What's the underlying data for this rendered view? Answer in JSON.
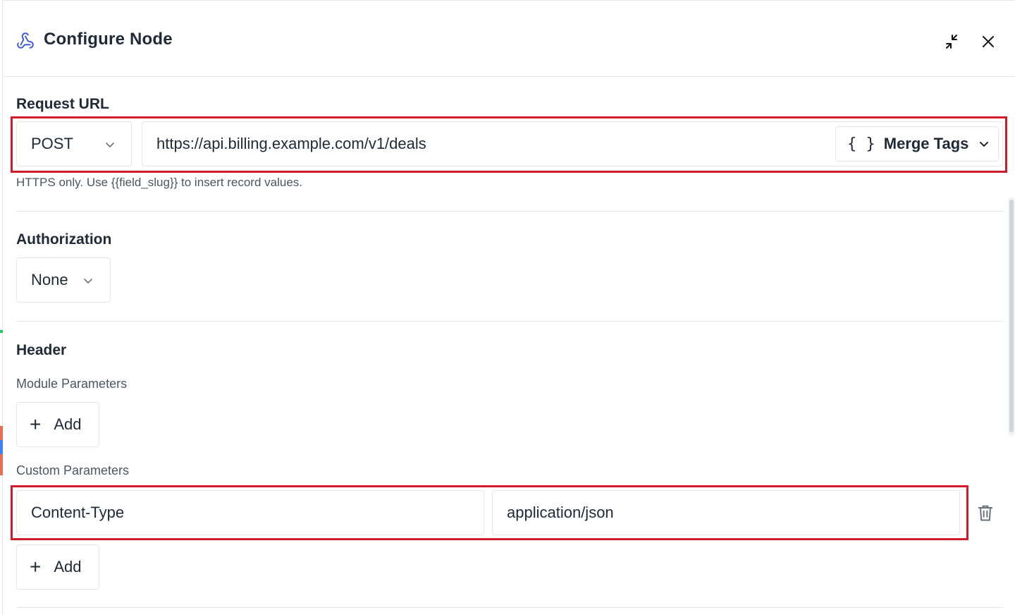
{
  "header": {
    "title": "Configure Node"
  },
  "request_url": {
    "label": "Request URL",
    "method": "POST",
    "url": "https://api.billing.example.com/v1/deals",
    "merge_tags_label": "Merge Tags",
    "merge_tags_glyph": "{ }",
    "hint": "HTTPS only. Use {{field_slug}} to insert record values."
  },
  "authorization": {
    "label": "Authorization",
    "value": "None"
  },
  "header_section": {
    "label": "Header",
    "module_params_label": "Module Parameters",
    "add_label": "Add",
    "custom_params_label": "Custom Parameters",
    "custom_params": [
      {
        "key": "Content-Type",
        "value": "application/json"
      }
    ],
    "add_label_2": "Add"
  },
  "icons": {
    "title": "webhook-icon",
    "minimize": "minimize-icon",
    "close": "close-icon",
    "delete": "trash-icon",
    "dropdown": "chevron-down-icon",
    "add": "plus-icon"
  },
  "colors": {
    "highlight": "#d11a2a",
    "accent": "#3b5bdb"
  }
}
